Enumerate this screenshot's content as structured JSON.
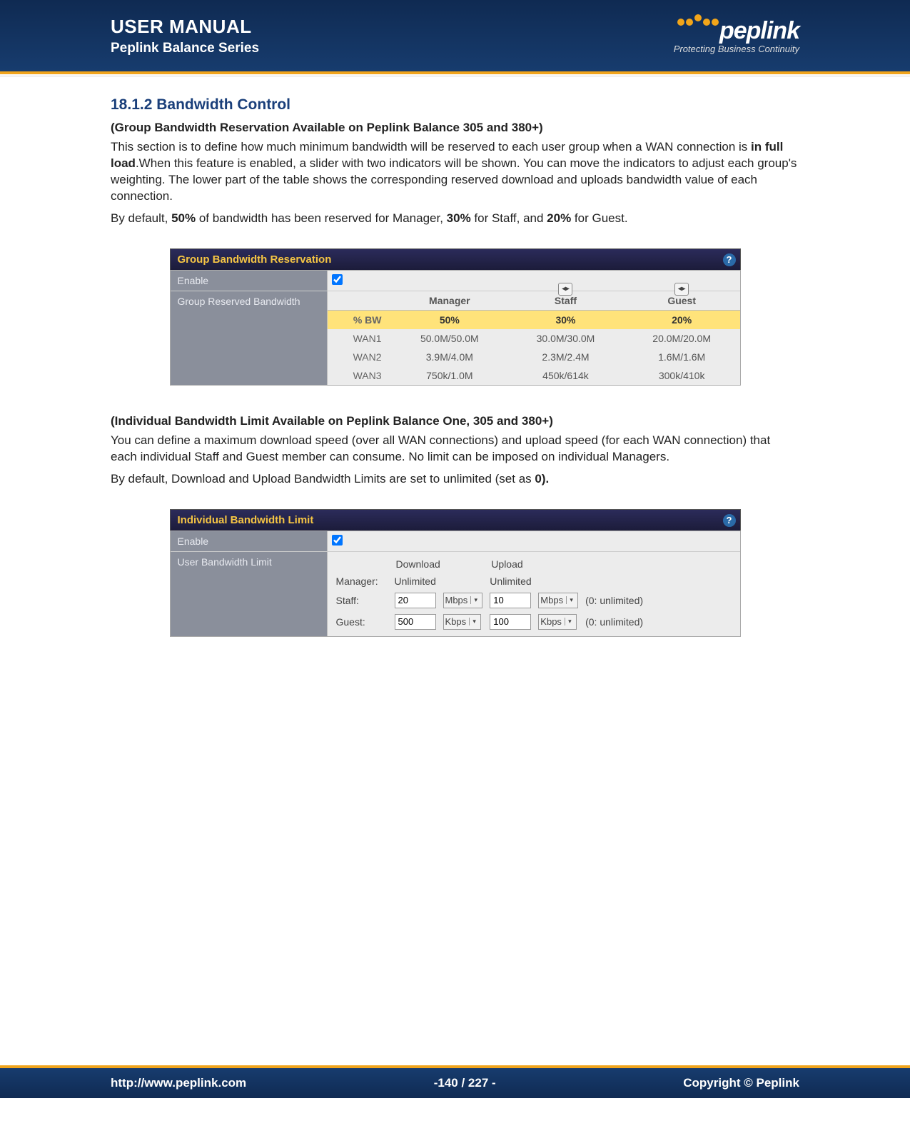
{
  "header": {
    "title": "USER MANUAL",
    "subtitle": "Peplink Balance Series",
    "logo_text": "peplink",
    "tagline": "Protecting Business Continuity"
  },
  "section": {
    "heading": "18.1.2 Bandwidth Control",
    "note1": "(Group Bandwidth Reservation Available on Peplink Balance 305 and 380+)",
    "para1_a": "This section is to define how much minimum bandwidth will be reserved to each user group when a WAN connection is ",
    "para1_b": "in full load",
    "para1_c": ".When this feature is enabled, a slider with two indicators will be shown. You can move the indicators to adjust each group's weighting. The lower part of the table shows the corresponding reserved download and uploads bandwidth value of each connection.",
    "para2_a": "By default, ",
    "para2_b": "50%",
    "para2_c": " of bandwidth has been reserved for Manager, ",
    "para2_d": "30%",
    "para2_e": " for Staff, and ",
    "para2_f": "20%",
    "para2_g": " for Guest.",
    "note2": "(Individual Bandwidth Limit Available on Peplink Balance One, 305 and 380+)",
    "para3": "You can define a maximum download speed (over all WAN connections) and upload speed (for each WAN connection) that each individual Staff and Guest member can consume. No limit can be imposed on individual Managers.",
    "para4_a": "By default, Download and Upload Bandwidth Limits are set to unlimited (set as ",
    "para4_b": "0).",
    "panel1": {
      "title": "Group Bandwidth Reservation",
      "enable_label": "Enable",
      "grb_label": "Group Reserved Bandwidth",
      "cols": {
        "c0": "",
        "c1": "Manager",
        "c2": "Staff",
        "c3": "Guest"
      },
      "pct_row": {
        "label": "% BW",
        "c1": "50%",
        "c2": "30%",
        "c3": "20%"
      },
      "rows": [
        {
          "label": "WAN1",
          "c1": "50.0M/50.0M",
          "c2": "30.0M/30.0M",
          "c3": "20.0M/20.0M"
        },
        {
          "label": "WAN2",
          "c1": "3.9M/4.0M",
          "c2": "2.3M/2.4M",
          "c3": "1.6M/1.6M"
        },
        {
          "label": "WAN3",
          "c1": "750k/1.0M",
          "c2": "450k/614k",
          "c3": "300k/410k"
        }
      ]
    },
    "panel2": {
      "title": "Individual Bandwidth Limit",
      "enable_label": "Enable",
      "ubl_label": "User Bandwidth Limit",
      "head_dl": "Download",
      "head_ul": "Upload",
      "manager_label": "Manager:",
      "manager_dl": "Unlimited",
      "manager_ul": "Unlimited",
      "staff_label": "Staff:",
      "staff_dl": "20",
      "staff_dl_unit": "Mbps",
      "staff_ul": "10",
      "staff_ul_unit": "Mbps",
      "guest_label": "Guest:",
      "guest_dl": "500",
      "guest_dl_unit": "Kbps",
      "guest_ul": "100",
      "guest_ul_unit": "Kbps",
      "unlim_note": "(0: unlimited)"
    }
  },
  "footer": {
    "url": "http://www.peplink.com",
    "page": "-140 / 227 -",
    "copyright": "Copyright ©  Peplink"
  }
}
